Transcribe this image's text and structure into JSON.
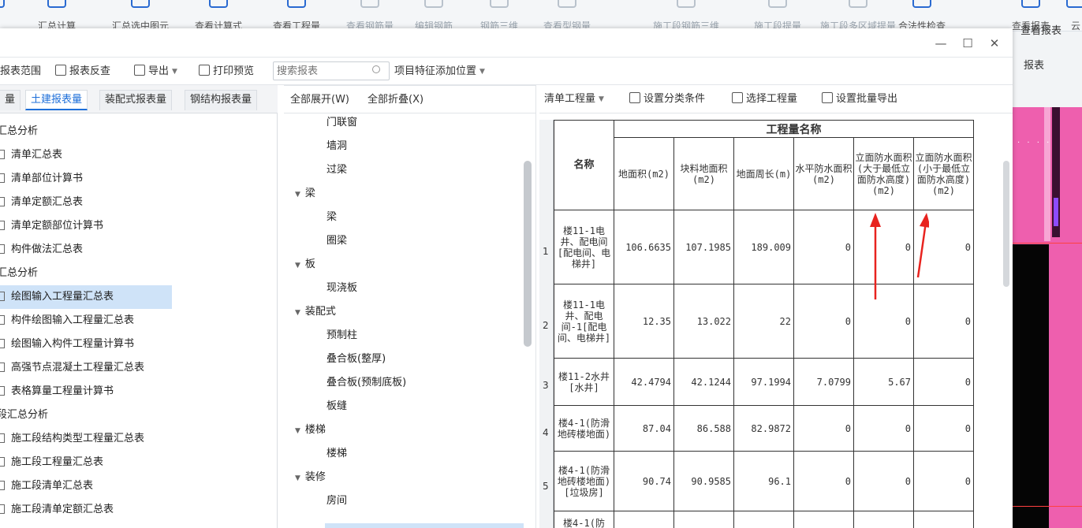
{
  "ribbon": {
    "items": [
      {
        "label": "算",
        "dim": false
      },
      {
        "label": "汇总计算",
        "dim": false
      },
      {
        "label": "汇总选中图元",
        "dim": false
      },
      {
        "label": "查看计算式",
        "dim": false
      },
      {
        "label": "查看工程量",
        "dim": false
      },
      {
        "label": "查看钢筋量",
        "dim": true
      },
      {
        "label": "编辑钢筋",
        "dim": true
      },
      {
        "label": "钢筋三维",
        "dim": true
      },
      {
        "label": "查看型钢量",
        "dim": true
      },
      {
        "label": "施工段钢筋三维",
        "dim": true
      },
      {
        "label": "施工段提量",
        "dim": true
      },
      {
        "label": "施工段多区域提量",
        "dim": true
      },
      {
        "label": "合法性检查",
        "dim": false
      },
      {
        "label": "查看报表",
        "dim": false
      },
      {
        "label": "云",
        "dim": false
      }
    ],
    "side_label": "报表"
  },
  "window": {
    "minimize": "—",
    "maximize": "☐",
    "close": "✕"
  },
  "toolbar": {
    "report_range": "报表范围",
    "report_check": "报表反查",
    "export": "导出",
    "print_preview": "打印预览",
    "search_placeholder": "搜索报表",
    "feature_position": "项目特征添加位置"
  },
  "tabs": [
    "量",
    "土建报表量",
    "装配式报表量",
    "钢结构报表量"
  ],
  "left_list": [
    {
      "label": "汇总分析",
      "type": "group"
    },
    {
      "label": "清单汇总表",
      "type": "item"
    },
    {
      "label": "清单部位计算书",
      "type": "item"
    },
    {
      "label": "清单定额汇总表",
      "type": "item"
    },
    {
      "label": "清单定额部位计算书",
      "type": "item"
    },
    {
      "label": "构件做法汇总表",
      "type": "item"
    },
    {
      "label": "汇总分析",
      "type": "group"
    },
    {
      "label": "绘图输入工程量汇总表",
      "type": "item",
      "selected": true
    },
    {
      "label": "构件绘图输入工程量汇总表",
      "type": "item"
    },
    {
      "label": "绘图输入构件工程量计算书",
      "type": "item"
    },
    {
      "label": "高强节点混凝土工程量汇总表",
      "type": "item"
    },
    {
      "label": "表格算量工程量计算书",
      "type": "item"
    },
    {
      "label": "段汇总分析",
      "type": "group"
    },
    {
      "label": "施工段结构类型工程量汇总表",
      "type": "item"
    },
    {
      "label": "施工段工程量汇总表",
      "type": "item"
    },
    {
      "label": "施工段清单汇总表",
      "type": "item"
    },
    {
      "label": "施工段清单定额汇总表",
      "type": "item"
    }
  ],
  "mid": {
    "expand_all": "全部展开(W)",
    "collapse_all": "全部折叠(X)",
    "tree": [
      {
        "label": "门联窗",
        "level": 1
      },
      {
        "label": "墙洞",
        "level": 1
      },
      {
        "label": "过梁",
        "level": 1
      },
      {
        "label": "梁",
        "level": 0
      },
      {
        "label": "梁",
        "level": 1
      },
      {
        "label": "圈梁",
        "level": 1
      },
      {
        "label": "板",
        "level": 0
      },
      {
        "label": "现浇板",
        "level": 1
      },
      {
        "label": "装配式",
        "level": 0
      },
      {
        "label": "预制柱",
        "level": 1
      },
      {
        "label": "叠合板(整厚)",
        "level": 1
      },
      {
        "label": "叠合板(预制底板)",
        "level": 1
      },
      {
        "label": "板缝",
        "level": 1
      },
      {
        "label": "楼梯",
        "level": 0
      },
      {
        "label": "楼梯",
        "level": 1
      },
      {
        "label": "装修",
        "level": 0
      },
      {
        "label": "房间",
        "level": 1
      }
    ]
  },
  "right": {
    "dropdown": "清单工程量",
    "set_category": "设置分类条件",
    "select_qty": "选择工程量",
    "batch_export": "设置批量导出",
    "table": {
      "group_header": "工程量名称",
      "name_header": "名称",
      "columns": [
        "地面积(m2)",
        "块料地面积(m2)",
        "地面周长(m)",
        "水平防水面积(m2)",
        "立面防水面积(大于最低立面防水高度)(m2)",
        "立面防水面积(小于最低立面防水高度)(m2)"
      ],
      "rows": [
        {
          "num": "1",
          "name": "楼11-1电井、配电间[配电间、电梯井]",
          "values": [
            "106.6635",
            "107.1985",
            "189.009",
            "0",
            "0",
            "0"
          ]
        },
        {
          "num": "2",
          "name": "楼11-1电井、配电间-1[配电间、电梯井]",
          "values": [
            "12.35",
            "13.022",
            "22",
            "0",
            "0",
            "0"
          ]
        },
        {
          "num": "3",
          "name": "楼11-2水井[水井]",
          "values": [
            "42.4794",
            "42.1244",
            "97.1994",
            "7.0799",
            "5.67",
            "0"
          ]
        },
        {
          "num": "4",
          "name": "楼4-1(防滑地砖楼地面)",
          "values": [
            "87.04",
            "86.588",
            "82.9872",
            "0",
            "0",
            "0"
          ]
        },
        {
          "num": "5",
          "name": "楼4-1(防滑地砖楼地面)[垃圾房]",
          "values": [
            "90.74",
            "90.9585",
            "96.1",
            "0",
            "0",
            "0"
          ]
        },
        {
          "num": "",
          "name": "楼4-1(防",
          "values": [
            "",
            "",
            "",
            "",
            "",
            ""
          ]
        }
      ]
    }
  },
  "colors": {
    "accent": "#1e6fd9",
    "selection": "#cfe3f8",
    "arrow": "#e8231f",
    "pink_bg": "#ee5fae"
  }
}
